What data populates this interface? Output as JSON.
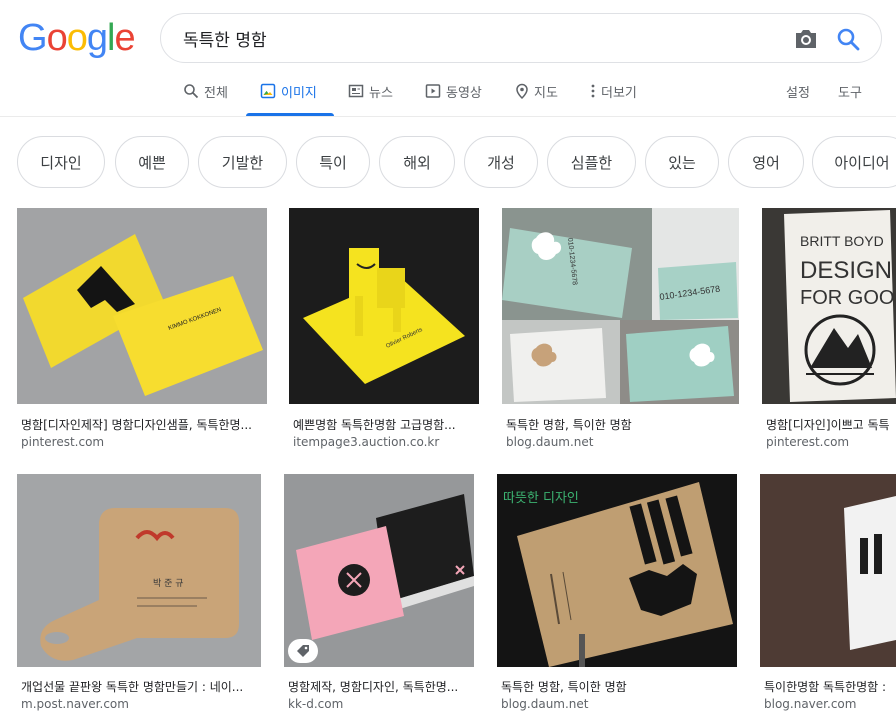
{
  "logo": {
    "letters": [
      "G",
      "o",
      "o",
      "g",
      "l",
      "e"
    ],
    "colors": [
      "#4285F4",
      "#EA4335",
      "#FBBC05",
      "#4285F4",
      "#34A853",
      "#EA4335"
    ]
  },
  "search": {
    "query": "독특한 명함",
    "camera_icon": "camera-icon",
    "search_icon": "search-icon"
  },
  "tabs": [
    {
      "label": "전체",
      "icon": "search-icon"
    },
    {
      "label": "이미지",
      "icon": "image-icon",
      "active": true
    },
    {
      "label": "뉴스",
      "icon": "news-icon"
    },
    {
      "label": "동영상",
      "icon": "video-icon"
    },
    {
      "label": "지도",
      "icon": "map-pin-icon"
    },
    {
      "label": "더보기",
      "icon": "more-vert-icon"
    }
  ],
  "tools": {
    "settings": "설정",
    "tools": "도구"
  },
  "chips": [
    "디자인",
    "예쁜",
    "기발한",
    "특이",
    "해외",
    "개성",
    "심플한",
    "있는",
    "영어",
    "아이디어"
  ],
  "results": [
    {
      "caption": "명함[디자인제작] 명함디자인샘플, 독특한명...",
      "site": "pinterest.com",
      "image_text": "KIMMO KOKKONEN"
    },
    {
      "caption": "예쁜명함 독특한명함 고급명함...",
      "site": "itempage3.auction.co.kr",
      "image_text": "Olivier Roberts"
    },
    {
      "caption": "독특한 명함, 특이한 명함",
      "site": "blog.daum.net",
      "image_text": "010-1234-5678"
    },
    {
      "caption": "명함[디자인]이쁘고 독특",
      "site": "pinterest.com",
      "image_text": [
        "BRITT BOYD",
        "DESIGN",
        "FOR GOOD"
      ]
    },
    {
      "caption": "개업선물 끝판왕 독특한 명함만들기 : 네이...",
      "site": "m.post.naver.com",
      "image_text": "박 준 규"
    },
    {
      "caption": "명함제작, 명함디자인, 독특한명...",
      "site": "kk-d.com",
      "image_text": ""
    },
    {
      "caption": "독특한 명함, 특이한 명함",
      "site": "blog.daum.net",
      "image_text": "따뜻한 디자인"
    },
    {
      "caption": "특이한명함 독특한명함 :",
      "site": "blog.naver.com",
      "image_text": ""
    }
  ],
  "colors": {
    "accent": "#1a73e8",
    "chip_border": "#dadce0",
    "site_text": "#5f6368"
  }
}
